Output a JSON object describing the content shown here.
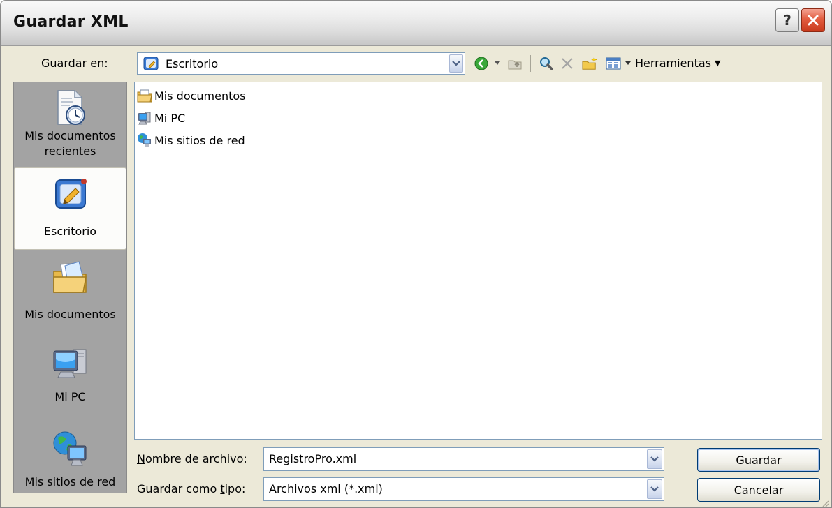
{
  "window": {
    "title": "Guardar XML"
  },
  "save_in": {
    "label_pre": "Guardar ",
    "label_u": "e",
    "label_post": "n:",
    "value": "Escritorio"
  },
  "toolbar": {
    "tools_pre": "",
    "tools_u": "H",
    "tools_post": "erramientas"
  },
  "places": [
    {
      "label": "Mis documentos recientes",
      "icon": "recent-documents-icon"
    },
    {
      "label": "Escritorio",
      "icon": "desktop-icon"
    },
    {
      "label": "Mis documentos",
      "icon": "my-documents-icon"
    },
    {
      "label": "Mi PC",
      "icon": "my-computer-icon"
    },
    {
      "label": "Mis sitios de red",
      "icon": "network-places-icon"
    }
  ],
  "files": [
    {
      "name": "Mis documentos",
      "icon": "folder-documents-icon"
    },
    {
      "name": "Mi PC",
      "icon": "computer-icon"
    },
    {
      "name": "Mis sitios de red",
      "icon": "network-icon"
    }
  ],
  "filename": {
    "label_pre": "",
    "label_u": "N",
    "label_post": "ombre de archivo:",
    "value": "RegistroPro.xml"
  },
  "filetype": {
    "label_pre": "Guardar como ",
    "label_u": "t",
    "label_post": "ipo:",
    "value": "Archivos xml (*.xml)"
  },
  "buttons": {
    "save_pre": "",
    "save_u": "G",
    "save_post": "uardar",
    "cancel": "Cancelar"
  },
  "colors": {
    "dialog_bg": "#ece9d8",
    "sidebar_bg": "#a3a3a3",
    "close_red": "#e25c3f",
    "border_blue": "#7f9db9"
  }
}
